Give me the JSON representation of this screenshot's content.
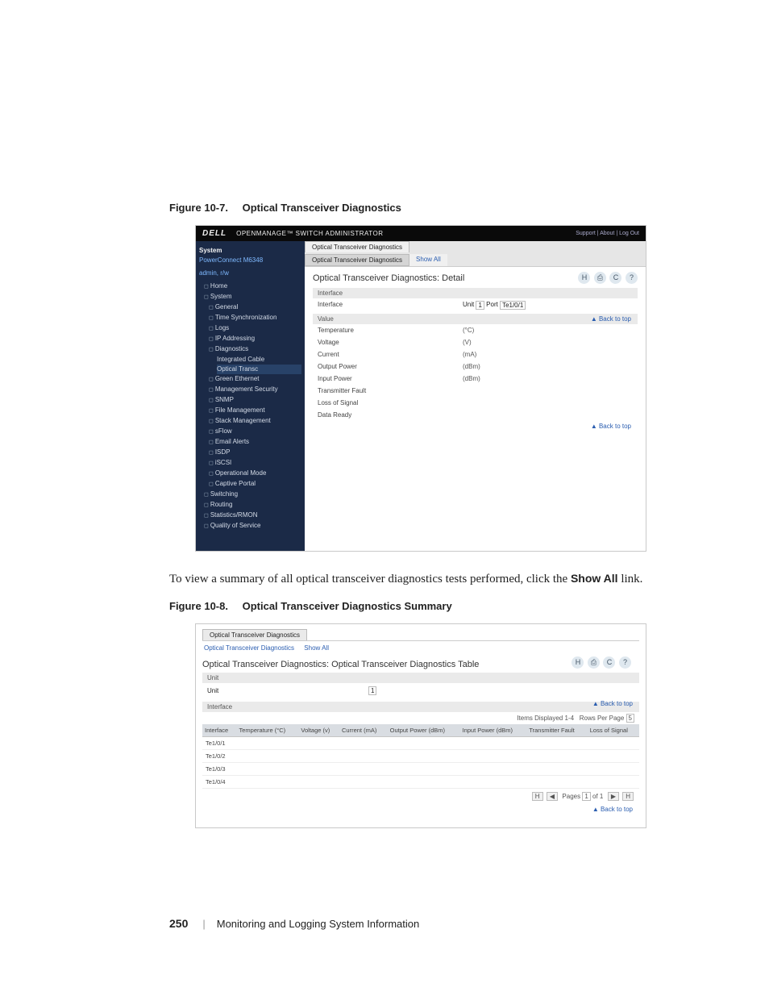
{
  "fig1_caption_num": "Figure 10-7.",
  "fig1_caption_title": "Optical Transceiver Diagnostics",
  "brand": "DELL",
  "om_title": "OPENMANAGE™ SWITCH ADMINISTRATOR",
  "top_links": "Support  |  About  |  Log Out",
  "side_sys": "System",
  "side_sub1": "PowerConnect M6348",
  "side_sub2": "admin, r/w",
  "nav_home": "Home",
  "nav_system": "System",
  "nav_items": {
    "a": "General",
    "b": "Time Synchronization",
    "c": "Logs",
    "d": "IP Addressing",
    "e": "Diagnostics",
    "e1": "Integrated Cable",
    "e2": "Optical Transc",
    "f": "Green Ethernet",
    "g": "Management Security",
    "h": "SNMP",
    "i": "File Management",
    "j": "Stack Management",
    "k": "sFlow",
    "l": "Email Alerts",
    "m": "ISDP",
    "n": "iSCSI",
    "o": "Operational Mode",
    "p": "Captive Portal"
  },
  "nav_switching": "Switching",
  "nav_routing": "Routing",
  "nav_stats": "Statistics/RMON",
  "nav_qos": "Quality of Service",
  "tab_main": "Optical Transceiver Diagnostics",
  "subtab_main": "Optical Transceiver Diagnostics",
  "subtab_showall": "Show All",
  "panel_title": "Optical Transceiver Diagnostics: Detail",
  "icons": {
    "save": "H",
    "print": "⎙",
    "refresh": "C",
    "help": "?"
  },
  "sec_interface": "Interface",
  "iface_label": "Interface",
  "iface_unit_lbl": "Unit",
  "iface_unit_val": "1",
  "iface_port_lbl": "Port",
  "iface_port_val": "Te1/0/1",
  "sec_value": "Value",
  "rows": {
    "r1l": "Temperature",
    "r1u": "(°C)",
    "r2l": "Voltage",
    "r2u": "(V)",
    "r3l": "Current",
    "r3u": "(mA)",
    "r4l": "Output Power",
    "r4u": "(dBm)",
    "r5l": "Input Power",
    "r5u": "(dBm)",
    "r6l": "Transmitter Fault",
    "r6u": "",
    "r7l": "Loss of Signal",
    "r7u": "",
    "r8l": "Data Ready",
    "r8u": ""
  },
  "back_link": "▲ Back to top",
  "body_para_a": "To view a summary of all optical transceiver diagnostics tests performed, click the ",
  "body_para_b": "Show All",
  "body_para_c": " link.",
  "fig2_caption_num": "Figure 10-8.",
  "fig2_caption_title": "Optical Transceiver Diagnostics Summary",
  "ss2_title": "Optical Transceiver Diagnostics: Optical Transceiver Diagnostics Table",
  "ss2_unit_h": "Unit",
  "ss2_unit_lbl": "Unit",
  "ss2_unit_val": "1",
  "ss2_iface_h": "Interface",
  "ss2_meta_items": "Items Displayed 1-4",
  "ss2_meta_rows_lbl": "Rows Per Page",
  "ss2_meta_rows_val": "5",
  "th": {
    "c0": "Interface",
    "c1": "Temperature (°C)",
    "c2": "Voltage (v)",
    "c3": "Current (mA)",
    "c4": "Output Power (dBm)",
    "c5": "Input Power (dBm)",
    "c6": "Transmitter Fault",
    "c7": "Loss of Signal"
  },
  "td": {
    "r1": "Te1/0/1",
    "r2": "Te1/0/2",
    "r3": "Te1/0/3",
    "r4": "Te1/0/4"
  },
  "pager_first": "H",
  "pager_prev": "◀",
  "pager_pages_lbl": "Pages",
  "pager_page": "1",
  "pager_of": "of 1",
  "pager_next": "▶",
  "pager_last": "H",
  "footer_pn": "250",
  "footer_sep": "|",
  "footer_title": "Monitoring and Logging System Information"
}
